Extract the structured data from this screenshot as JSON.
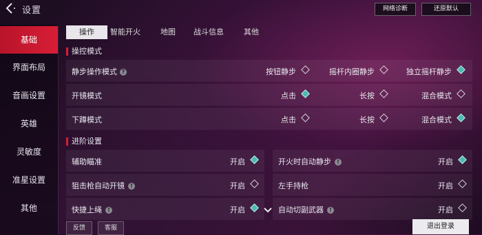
{
  "header": {
    "title": "设置",
    "diag_label": "网络诊断",
    "reset_label": "还原默认"
  },
  "sidebar": {
    "items": [
      {
        "label": "基础"
      },
      {
        "label": "界面布局"
      },
      {
        "label": "音画设置"
      },
      {
        "label": "英雄"
      },
      {
        "label": "灵敏度"
      },
      {
        "label": "准星设置"
      },
      {
        "label": "其他"
      }
    ]
  },
  "tabs": [
    {
      "label": "操作"
    },
    {
      "label": "智能开火"
    },
    {
      "label": "地图"
    },
    {
      "label": "战斗信息"
    },
    {
      "label": "其他"
    }
  ],
  "sections": {
    "control": {
      "title": "操控模式",
      "rows": [
        {
          "label": "静步操作模式",
          "options": [
            {
              "label": "按钮静步",
              "on": false
            },
            {
              "label": "摇杆内圈静步",
              "on": false
            },
            {
              "label": "独立摇杆静步",
              "on": true
            }
          ]
        },
        {
          "label": "开镜模式",
          "options": [
            {
              "label": "点击",
              "on": true
            },
            {
              "label": "长按",
              "on": false
            },
            {
              "label": "混合模式",
              "on": false
            }
          ]
        },
        {
          "label": "下蹲模式",
          "options": [
            {
              "label": "点击",
              "on": false
            },
            {
              "label": "长按",
              "on": false
            },
            {
              "label": "混合模式",
              "on": true
            }
          ]
        }
      ]
    },
    "advanced": {
      "title": "进阶设置",
      "left": [
        {
          "label": "辅助瞄准",
          "value": "开启",
          "on": true
        },
        {
          "label": "狙击枪自动开镜",
          "value": "开启",
          "on": false
        },
        {
          "label": "快捷上绳",
          "value": "开启",
          "on": true
        }
      ],
      "right": [
        {
          "label": "开火时自动静步",
          "value": "开启",
          "on": true
        },
        {
          "label": "左手持枪",
          "value": "开启",
          "on": false
        },
        {
          "label": "自动切副武器",
          "value": "开启",
          "on": false
        }
      ]
    }
  },
  "footer": {
    "feedback_label": "反馈",
    "service_label": "客服",
    "logout_label": "退出登录"
  }
}
